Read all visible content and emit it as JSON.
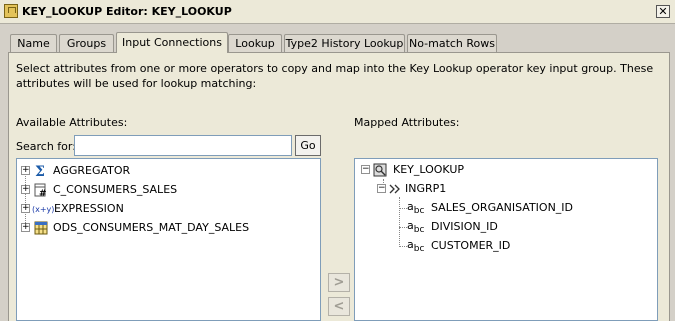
{
  "window": {
    "title": "KEY_LOOKUP Editor: KEY_LOOKUP",
    "close_glyph": "✕"
  },
  "tabs": [
    {
      "label": "Name",
      "active": false
    },
    {
      "label": "Groups",
      "active": false
    },
    {
      "label": "Input Connections",
      "active": true
    },
    {
      "label": "Lookup",
      "active": false
    },
    {
      "label": "Type2 History Lookup",
      "active": false
    },
    {
      "label": "No-match Rows",
      "active": false
    }
  ],
  "description": "Select attributes from one or more operators to copy and map into the Key Lookup operator key input group.  These attributes will be used for lookup matching:",
  "available": {
    "label": "Available Attributes:",
    "search_label": "Search for:",
    "search_value": "",
    "go_label": "Go",
    "items": [
      {
        "label": "AGGREGATOR",
        "icon": "sigma-icon"
      },
      {
        "label": "C_CONSUMERS_SALES",
        "icon": "table-hash-icon"
      },
      {
        "label": "EXPRESSION",
        "icon": "expression-icon"
      },
      {
        "label": "ODS_CONSUMERS_MAT_DAY_SALES",
        "icon": "table-icon"
      }
    ]
  },
  "mapped": {
    "label": "Mapped Attributes:",
    "root": "KEY_LOOKUP",
    "group": "INGRP1",
    "attributes": [
      "SALES_ORGANISATION_ID",
      "DIVISION_ID",
      "CUSTOMER_ID"
    ]
  },
  "buttons": {
    "add_glyph": ">",
    "remove_glyph": "<"
  }
}
